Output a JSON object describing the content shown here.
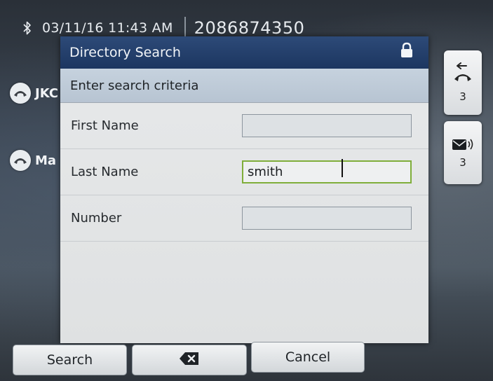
{
  "status_bar": {
    "datetime": "03/11/16 11:43 AM",
    "phone_number": "2086874350",
    "bluetooth_icon": "bluetooth-icon"
  },
  "background_lines": [
    {
      "label": "JKC",
      "icon": "handset-icon"
    },
    {
      "label": "Ma",
      "icon": "handset-icon"
    }
  ],
  "side_tabs": {
    "missed_calls": {
      "icon": "missed-call-icon",
      "count": "3"
    },
    "voicemail": {
      "icon": "voicemail-icon",
      "count": "3"
    }
  },
  "dialog": {
    "title": "Directory Search",
    "lock_icon": "lock-icon",
    "subheader": "Enter search criteria",
    "fields": [
      {
        "label": "First Name",
        "value": ""
      },
      {
        "label": "Last Name",
        "value": "smith"
      },
      {
        "label": "Number",
        "value": ""
      }
    ]
  },
  "softkeys": {
    "search": "Search",
    "backspace_icon": "backspace-icon",
    "cancel": "Cancel"
  },
  "colors": {
    "header_blue": "#1c3660",
    "subheader_blue": "#c6d2de",
    "active_border": "#7fae3a"
  }
}
